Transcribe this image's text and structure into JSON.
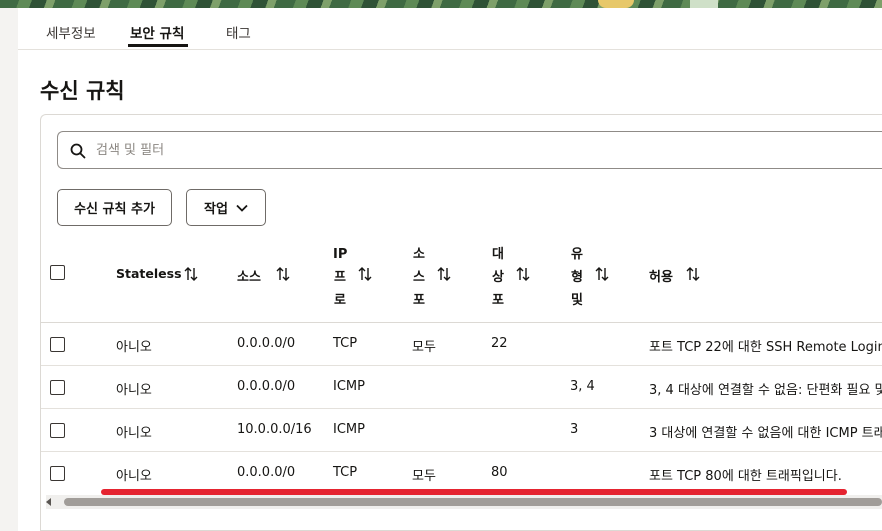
{
  "tabs": [
    {
      "label": "세부정보"
    },
    {
      "label": "보안 규칙"
    },
    {
      "label": "태그"
    }
  ],
  "page_title": "수신 규칙",
  "search": {
    "placeholder": "검색 및 필터"
  },
  "buttons": {
    "add_rule": "수신 규칙 추가",
    "actions": "작업"
  },
  "columns": {
    "stateless": "Stateless",
    "source": "소스",
    "ip_protocol": [
      "IP",
      "프",
      "로"
    ],
    "source_port": [
      "소",
      "스",
      "포"
    ],
    "dest_port": [
      "대",
      "상",
      "포"
    ],
    "type_code": [
      "유",
      "형",
      "및"
    ],
    "description": "허용"
  },
  "rows": [
    {
      "stateless": "아니오",
      "source": "0.0.0.0/0",
      "protocol": "TCP",
      "source_port": "모두",
      "dest_port": "22",
      "type_code": "",
      "description": "포트 TCP 22에 대한 SSH Remote Login"
    },
    {
      "stateless": "아니오",
      "source": "0.0.0.0/0",
      "protocol": "ICMP",
      "source_port": "",
      "dest_port": "",
      "type_code": "3, 4",
      "description": "3, 4 대상에 연결할 수 없음: 단편화 필요 및"
    },
    {
      "stateless": "아니오",
      "source": "10.0.0.0/16",
      "protocol": "ICMP",
      "source_port": "",
      "dest_port": "",
      "type_code": "3",
      "description": "3 대상에 연결할 수 없음에 대한 ICMP 트래"
    },
    {
      "stateless": "아니오",
      "source": "0.0.0.0/0",
      "protocol": "TCP",
      "source_port": "모두",
      "dest_port": "80",
      "type_code": "",
      "description": "포트 TCP 80에 대한 트래픽입니다."
    }
  ],
  "colors": {
    "accent": "#161513",
    "highlight": "#e52430"
  }
}
